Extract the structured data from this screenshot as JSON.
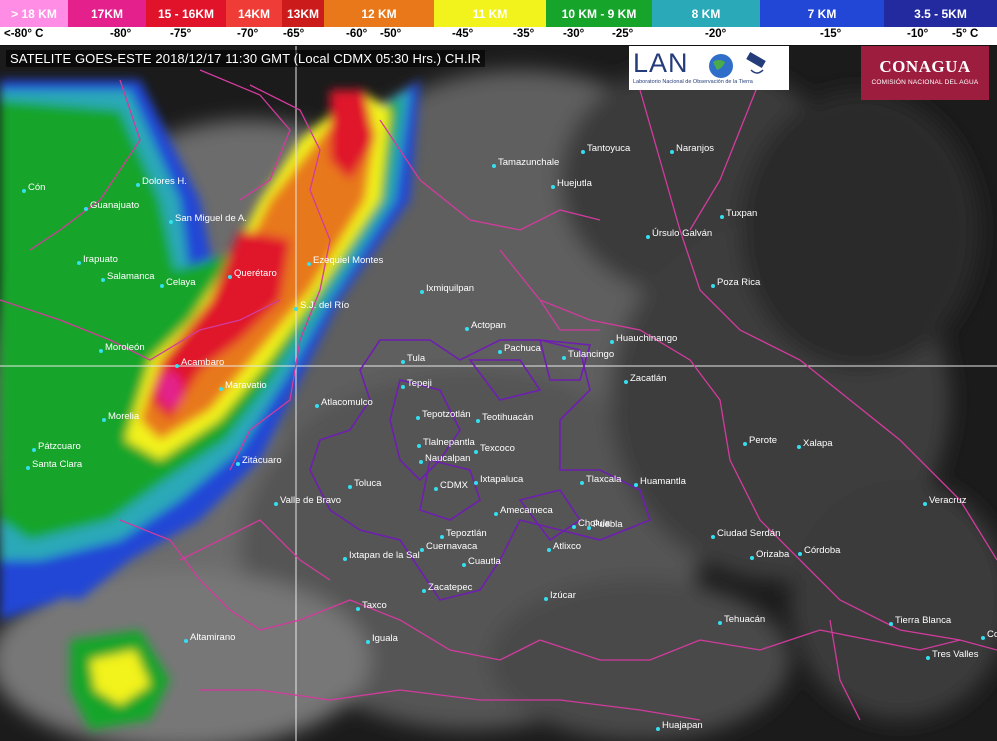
{
  "header": {
    "title": "SATELITE GOES-ESTE 2018/12/17 11:30 GMT (Local CDMX 05:30 Hrs.) CH.IR"
  },
  "logos": {
    "lanot_text": "LAN",
    "lanot_subtitle": "Laboratorio Nacional de Observación de la Tierra",
    "conagua_name": "CONAGUA",
    "conagua_subtitle": "COMISIÓN NACIONAL DEL AGUA"
  },
  "scale": {
    "segments": [
      {
        "label": "> 18 KM",
        "color": "#ff8de6"
      },
      {
        "label": "17KM",
        "color": "#e3208c"
      },
      {
        "label": "15 - 16KM",
        "color": "#e0132b"
      },
      {
        "label": "14KM",
        "color": "#f03c36"
      },
      {
        "label": "13KM",
        "color": "#cc1b1b"
      },
      {
        "label": "12 KM",
        "color": "#e8781a"
      },
      {
        "label": "11 KM",
        "color": "#f2f21c"
      },
      {
        "label": "10 KM - 9 KM",
        "color": "#16a52a"
      },
      {
        "label": "8 KM",
        "color": "#2aa9b8"
      },
      {
        "label": "7 KM",
        "color": "#2246d6"
      },
      {
        "label": "3.5 - 5KM",
        "color": "#232aa0"
      }
    ],
    "temps": [
      "<-80° C",
      "-80°",
      "-75°",
      "-70°",
      "-65°",
      "-60°",
      "-50°",
      "-45°",
      "-35°",
      "-30°",
      "-25°",
      "-20°",
      "-15°",
      "-10°",
      "-5° C"
    ]
  },
  "cities": [
    {
      "name": "Cón"
    },
    {
      "name": "Dolores H."
    },
    {
      "name": "Guanajuato"
    },
    {
      "name": "San Miguel de A."
    },
    {
      "name": "Irapuato"
    },
    {
      "name": "Salamanca"
    },
    {
      "name": "Celaya"
    },
    {
      "name": "Querétaro"
    },
    {
      "name": "Ezequiel Montes"
    },
    {
      "name": "S.J. del Río"
    },
    {
      "name": "Tamazunchale"
    },
    {
      "name": "Huejutla"
    },
    {
      "name": "Tantoyuca"
    },
    {
      "name": "Naranjos"
    },
    {
      "name": "Tuxpan"
    },
    {
      "name": "Úrsulo Galván"
    },
    {
      "name": "Poza Rica"
    },
    {
      "name": "Ixmiquilpan"
    },
    {
      "name": "Actopan"
    },
    {
      "name": "Pachuca"
    },
    {
      "name": "Tulancingo"
    },
    {
      "name": "Huauchinango"
    },
    {
      "name": "Zacatlán"
    },
    {
      "name": "Tula"
    },
    {
      "name": "Tepeji"
    },
    {
      "name": "Moroleón"
    },
    {
      "name": "Acambaro"
    },
    {
      "name": "Maravatio"
    },
    {
      "name": "Atlacomulco"
    },
    {
      "name": "Tepotzotlán"
    },
    {
      "name": "Teotihuacán"
    },
    {
      "name": "Morelia"
    },
    {
      "name": "Pátzcuaro"
    },
    {
      "name": "Santa Clara"
    },
    {
      "name": "Zitácuaro"
    },
    {
      "name": "Tlalnepantla"
    },
    {
      "name": "Texcoco"
    },
    {
      "name": "Naucalpan"
    },
    {
      "name": "Perote"
    },
    {
      "name": "Xalapa"
    },
    {
      "name": "Ixtapaluca"
    },
    {
      "name": "Tlaxcala"
    },
    {
      "name": "Huamantla"
    },
    {
      "name": "Toluca"
    },
    {
      "name": "CDMX"
    },
    {
      "name": "Valle de Bravo"
    },
    {
      "name": "Amecameca"
    },
    {
      "name": "Veracruz"
    },
    {
      "name": "Cholula"
    },
    {
      "name": "Puebla"
    },
    {
      "name": "Tepoztlán"
    },
    {
      "name": "Ciudad Serdán"
    },
    {
      "name": "Cuernavaca"
    },
    {
      "name": "Ixtapan de la Sal"
    },
    {
      "name": "Cuautla"
    },
    {
      "name": "Atlixco"
    },
    {
      "name": "Orizaba"
    },
    {
      "name": "Córdoba"
    },
    {
      "name": "Zacatepec"
    },
    {
      "name": "Izúcar"
    },
    {
      "name": "Taxco"
    },
    {
      "name": "Tehuacán"
    },
    {
      "name": "Tierra Blanca"
    },
    {
      "name": "Iguala"
    },
    {
      "name": "Altamirano"
    },
    {
      "name": "Tres Valles"
    },
    {
      "name": "Huajapan"
    },
    {
      "name": "Co"
    }
  ]
}
